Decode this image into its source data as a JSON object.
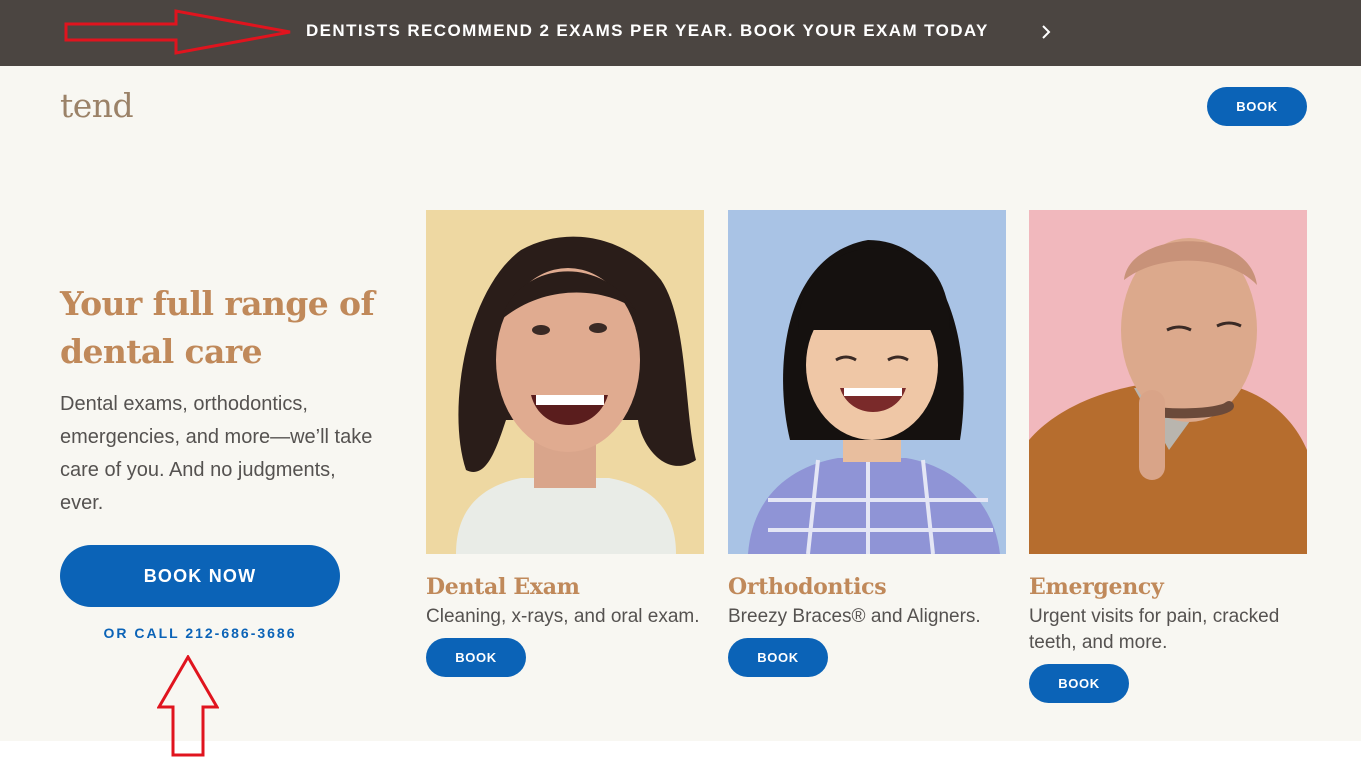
{
  "promo_bar": {
    "text": "DENTISTS RECOMMEND 2 EXAMS PER YEAR. BOOK YOUR EXAM TODAY",
    "chevron_icon": "chevron-right-icon",
    "background": "#4b4541"
  },
  "header": {
    "logo": "tend",
    "book_label": "BOOK"
  },
  "hero": {
    "headline": "Your full range of dental care",
    "description": "Dental exams, orthodontics, emergencies, and more—we’ll take care of you. And no judgments, ever.",
    "cta_label": "BOOK NOW",
    "call_text": "OR CALL 212-686-3686"
  },
  "services": [
    {
      "title": "Dental Exam",
      "description": "Cleaning, x-rays, and oral exam.",
      "book_label": "BOOK",
      "photo_bg": "#eed8a2"
    },
    {
      "title": "Orthodontics",
      "description": "Breezy Braces® and Aligners.",
      "book_label": "BOOK",
      "photo_bg": "#a9c3e5"
    },
    {
      "title": "Emergency",
      "description": "Urgent visits for pain, cracked teeth, and more.",
      "book_label": "BOOK",
      "photo_bg": "#f1b8bd"
    }
  ],
  "colors": {
    "accent_blue": "#0b63b7",
    "heading_tan": "#c0895a",
    "page_bg": "#f8f7f2",
    "annotation_red": "#e0141e"
  }
}
